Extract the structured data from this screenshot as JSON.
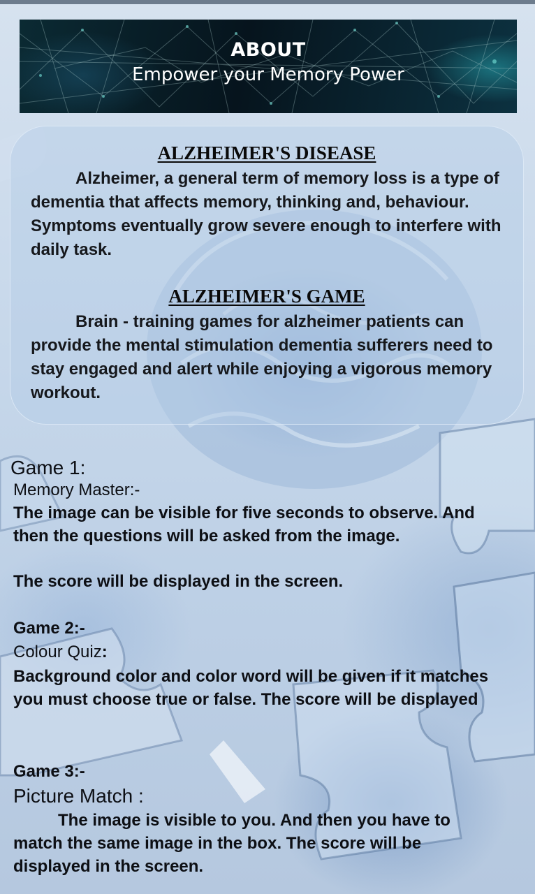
{
  "banner": {
    "title": "ABOUT",
    "subtitle": "Empower your Memory Power"
  },
  "about": {
    "disease_heading": "ALZHEIMER'S DISEASE",
    "disease_text": "Alzheimer, a general  term of memory loss is a type of dementia that affects memory, thinking and, behaviour. Symptoms eventually grow severe enough to interfere with daily task.",
    "game_heading": "ALZHEIMER'S GAME",
    "game_text": "Brain - training games for alzheimer patients can provide the mental stimulation dementia sufferers need to stay engaged and alert while enjoying a vigorous memory workout."
  },
  "games": {
    "game1": {
      "label": "Game 1:",
      "name": "Memory Master:-",
      "description": "The image can be visible for five seconds to observe. And then the questions will be asked from the image.",
      "score_note": "The score will be displayed in the screen."
    },
    "game2": {
      "label": "Game 2:-",
      "name": "Colour Quiz",
      "name_suffix": ":",
      "description": "Background color and color word will be given if it matches you must choose true or false.  The score will be displayed"
    },
    "game3": {
      "label": "Game 3:-",
      "name": "Picture Match :",
      "description": "The  image is visible to you. And then you have to match the same image in the box. The score will be displayed in the screen."
    }
  },
  "colors": {
    "background": "#c6d7ea",
    "banner": "#06141d",
    "text": "#0d0f14"
  }
}
